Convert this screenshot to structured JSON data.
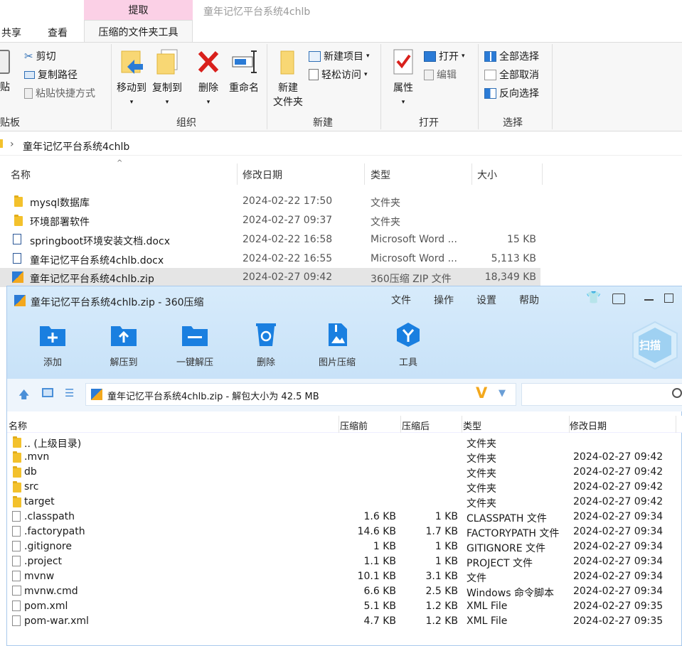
{
  "explorer": {
    "context_tab": "提取",
    "window_title": "童年记忆平台系统4chlb",
    "ribbon_tabs": [
      "共享",
      "查看",
      "压缩的文件夹工具"
    ],
    "ribbon": {
      "clipboard": {
        "partial_paste": "贴",
        "cut": "剪切",
        "copy_path": "复制路径",
        "paste_shortcut": "粘贴快捷方式",
        "label": "贴板"
      },
      "organize": {
        "move_to": "移动到",
        "copy_to": "复制到",
        "delete": "删除",
        "rename": "重命名",
        "label": "组织"
      },
      "new": {
        "new_folder_1": "新建",
        "new_folder_2": "文件夹",
        "new_item": "新建项目",
        "easy_access": "轻松访问",
        "label": "新建"
      },
      "open": {
        "properties": "属性",
        "open": "打开",
        "edit": "编辑",
        "label": "打开"
      },
      "select": {
        "select_all": "全部选择",
        "select_none": "全部取消",
        "invert": "反向选择",
        "label": "选择"
      }
    },
    "address": "童年记忆平台系统4chlb",
    "columns": {
      "name": "名称",
      "modified": "修改日期",
      "type": "类型",
      "size": "大小"
    },
    "files": [
      {
        "name": "mysql数据库",
        "modified": "2024-02-22 17:50",
        "type": "文件夹",
        "size": ""
      },
      {
        "name": "环境部署软件",
        "modified": "2024-02-27 09:37",
        "type": "文件夹",
        "size": ""
      },
      {
        "name": "springboot环境安装文档.docx",
        "modified": "2024-02-22 16:58",
        "type": "Microsoft Word ...",
        "size": "15 KB"
      },
      {
        "name": "童年记忆平台系统4chlb.docx",
        "modified": "2024-02-22 16:55",
        "type": "Microsoft Word ...",
        "size": "5,113 KB"
      },
      {
        "name": "童年记忆平台系统4chlb.zip",
        "modified": "2024-02-27 09:42",
        "type": "360压缩 ZIP 文件",
        "size": "18,349 KB"
      }
    ]
  },
  "zip": {
    "title": "童年记忆平台系统4chlb.zip - 360压缩",
    "menu": [
      "文件",
      "操作",
      "设置",
      "帮助"
    ],
    "tools": [
      "添加",
      "解压到",
      "一键解压",
      "删除",
      "图片压缩",
      "工具"
    ],
    "scan_label": "扫描",
    "path": "童年记忆平台系统4chlb.zip - 解包大小为 42.5 MB",
    "columns": {
      "name": "名称",
      "before": "压缩前",
      "after": "压缩后",
      "type": "类型",
      "modified": "修改日期"
    },
    "rows": [
      {
        "name": ".. (上级目录)",
        "before": "",
        "after": "",
        "type": "文件夹",
        "modified": "",
        "kind": "folder"
      },
      {
        "name": ".mvn",
        "before": "",
        "after": "",
        "type": "文件夹",
        "modified": "2024-02-27 09:42",
        "kind": "folder"
      },
      {
        "name": "db",
        "before": "",
        "after": "",
        "type": "文件夹",
        "modified": "2024-02-27 09:42",
        "kind": "folder"
      },
      {
        "name": "src",
        "before": "",
        "after": "",
        "type": "文件夹",
        "modified": "2024-02-27 09:42",
        "kind": "folder"
      },
      {
        "name": "target",
        "before": "",
        "after": "",
        "type": "文件夹",
        "modified": "2024-02-27 09:42",
        "kind": "folder"
      },
      {
        "name": ".classpath",
        "before": "1.6 KB",
        "after": "1 KB",
        "type": "CLASSPATH 文件",
        "modified": "2024-02-27 09:34",
        "kind": "file"
      },
      {
        "name": ".factorypath",
        "before": "14.6 KB",
        "after": "1.7 KB",
        "type": "FACTORYPATH 文件",
        "modified": "2024-02-27 09:34",
        "kind": "file"
      },
      {
        "name": ".gitignore",
        "before": "1 KB",
        "after": "1 KB",
        "type": "GITIGNORE 文件",
        "modified": "2024-02-27 09:34",
        "kind": "file"
      },
      {
        "name": ".project",
        "before": "1.1 KB",
        "after": "1 KB",
        "type": "PROJECT 文件",
        "modified": "2024-02-27 09:34",
        "kind": "file"
      },
      {
        "name": "mvnw",
        "before": "10.1 KB",
        "after": "3.1 KB",
        "type": "文件",
        "modified": "2024-02-27 09:34",
        "kind": "file"
      },
      {
        "name": "mvnw.cmd",
        "before": "6.6 KB",
        "after": "2.5 KB",
        "type": "Windows 命令脚本",
        "modified": "2024-02-27 09:34",
        "kind": "cmd"
      },
      {
        "name": "pom.xml",
        "before": "5.1 KB",
        "after": "1.2 KB",
        "type": "XML File",
        "modified": "2024-02-27 09:35",
        "kind": "file"
      },
      {
        "name": "pom-war.xml",
        "before": "4.7 KB",
        "after": "1.2 KB",
        "type": "XML File",
        "modified": "2024-02-27 09:35",
        "kind": "file"
      }
    ]
  }
}
